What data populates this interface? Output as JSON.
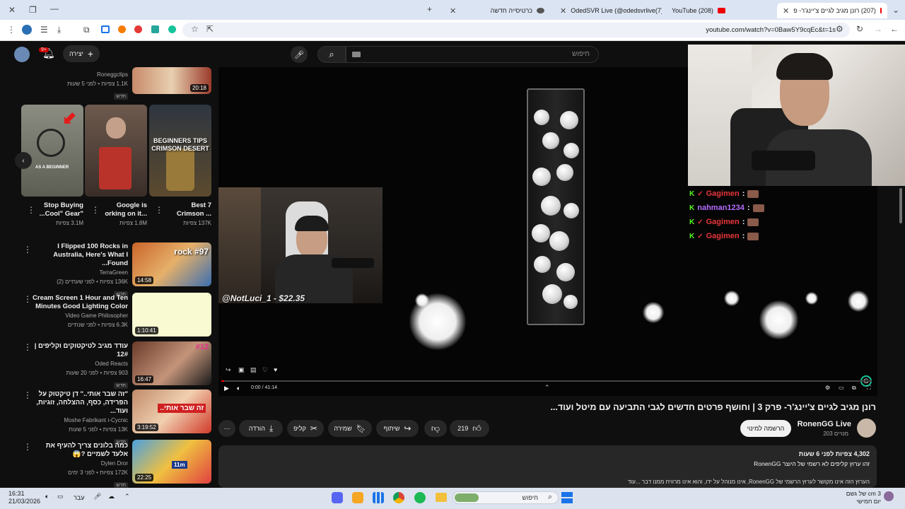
{
  "browser": {
    "tabs": [
      {
        "label": "(207) רונן מגיב לגיים צ'יינג'ר- פ",
        "active": true
      },
      {
        "label": "(208) YouTube"
      },
      {
        "label": "(7)OdedSVR Live (@odedsvrlive"
      },
      {
        "label": "כרטיסייה חדשה"
      }
    ],
    "url": "youtube.com/watch?v=0Baw5Y9cqEc&t=1s"
  },
  "header": {
    "create_label": "יצירה",
    "notif_count": "9+",
    "search_placeholder": "חיפוש"
  },
  "player": {
    "donation": "@NotLuci_1 - $22.35",
    "time": "0:00 / 41:14"
  },
  "chat": [
    {
      "user": "Gagimen",
      "color": "#e8363c"
    },
    {
      "user": "nahman1234",
      "color": "#b46dff"
    },
    {
      "user": "Gagimen",
      "color": "#e8363c"
    },
    {
      "user": "Gagimen",
      "color": "#e8363c"
    }
  ],
  "video": {
    "title": "רונן מגיב לגיים צ'יינג'ר- פרק 3 | וחושף פרטים חדשים לגבי התביעה עם מיטל ועוד...",
    "channel": "RonenGG Live",
    "subs": "203 מנויים",
    "subscribe": "הרשמה למינוי",
    "likes": "219",
    "share": "שיתוף",
    "save": "שמירה",
    "clip": "קליפ",
    "download": "הורדה",
    "description": {
      "stats": "4,302 צפיות  לפני 6 שעות",
      "line1": "זהו ערוץ קליפים לא רשמי של היוצר RonenGG",
      "line3": "הערוץ הזה אינו מקושר לערוץ הרשמי של RonenGG, אינו מנוהל על ידו, והוא אינו מרוויח ממנו דבר ...עוד"
    }
  },
  "sidebar": {
    "top": {
      "channel": "Roneggclips",
      "meta": "1.1K צפיות • לפני 5 שעות",
      "badge": "חדש",
      "duration": "20:18"
    },
    "shorts": [
      {
        "title_l1": "Stop Buying",
        "title_l2": "\"Cool\" Gear...",
        "views": "3.1M צפיות",
        "overlay": "AS A BEGINNER"
      },
      {
        "title_l1": "Google is",
        "title_l2": "...orking on it",
        "views": "1.8M צפיות"
      },
      {
        "title_l1": "Best 7",
        "title_l2": "... Crimson",
        "views": "137K צפיות",
        "overlay": "BEGINNERS TIPS CRIMSON DESERT"
      }
    ],
    "videos": [
      {
        "title": "I Flipped 100 Rocks in Australia, Here's What I Found...",
        "channel": "TerraGreen",
        "meta": "136K צפיות • לפני שעתיים (2)",
        "badge": "חדש",
        "duration": "14:58",
        "overlay": "rock #97"
      },
      {
        "title": "Cream Screen 1 Hour and Ten Minutes Good Lighting Color",
        "channel": "Video Game Philosopher",
        "meta": "6.3K צפיות • לפני שנתיים",
        "duration": "1:10:41"
      },
      {
        "title": "עודד מגיב לטיקטוקים וקליפים | 12#",
        "channel": "Oded Reacts",
        "meta": "903 צפיות • לפני 20 שעות",
        "badge": "חדש",
        "duration": "16:47",
        "overlay": "#12"
      },
      {
        "title": "\"זה שבר אותי..\" דן טיקטוק על הפרידה, כסף, ההצלחה, זוגיות, ועוד...",
        "channel": "Cycnic-ו Moshe Fabrikant",
        "meta": "13K צפיות • לפני 5 שעות",
        "badge": "חדש",
        "duration": "3:19:52",
        "overlay": "זה שבר אותי.."
      },
      {
        "title": "כמה בלונים צריך להעיף את אלעד לשמיים ?😱",
        "channel": "Dylen Dror",
        "meta": "172K צפיות • לפני 3 ימים",
        "badge": "חדש",
        "duration": "22:25",
        "overlay": "11m"
      }
    ]
  },
  "taskbar": {
    "time": "16:31",
    "date": "21/03/2026",
    "lang": "עבר",
    "search": "חיפוש",
    "weather_l1": "3 cm של גשם",
    "weather_l2": "יום חמישי"
  }
}
